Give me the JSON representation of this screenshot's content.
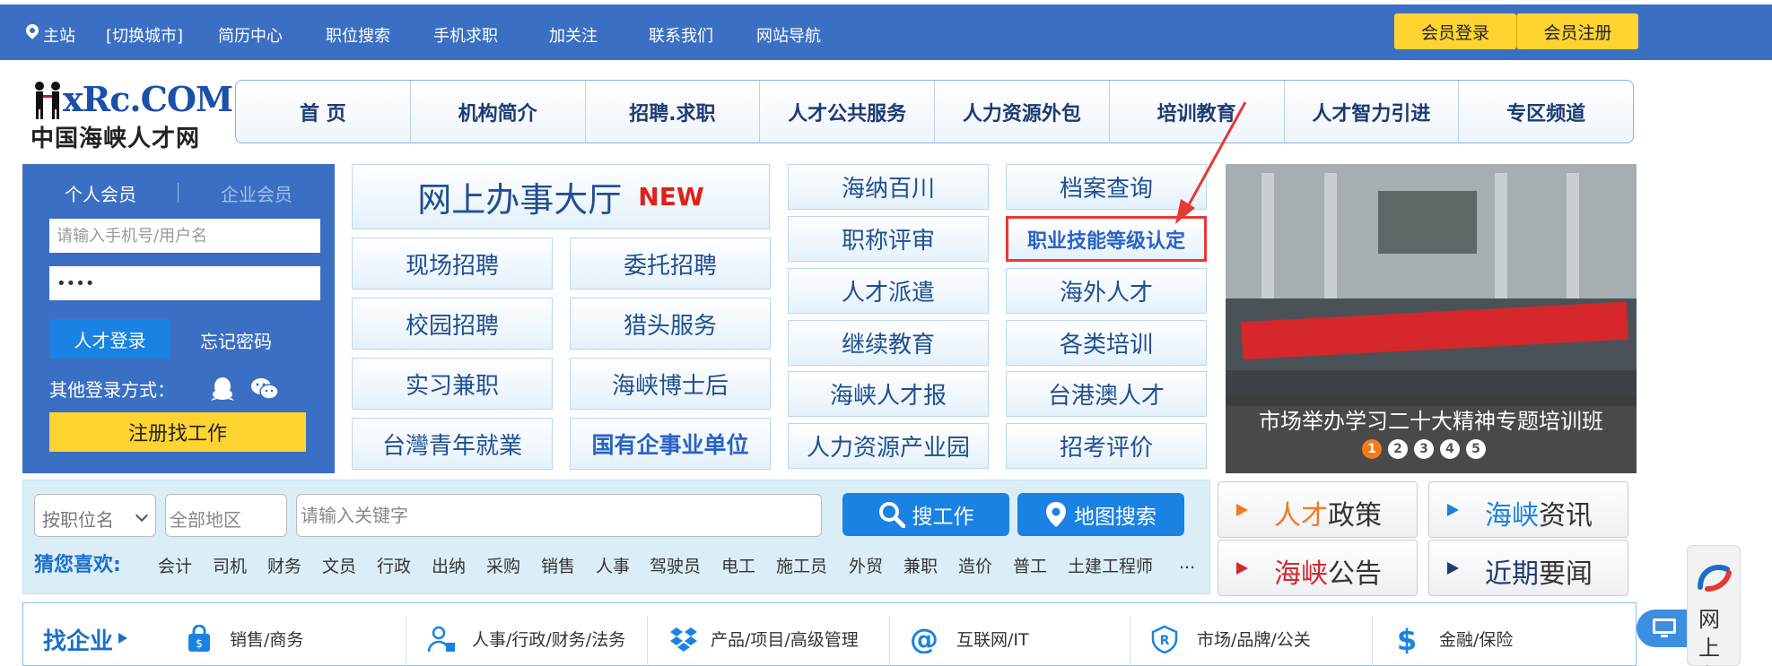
{
  "topbar": {
    "location": "主站",
    "switch_city": "[切换城市]",
    "links": [
      "简历中心",
      "职位搜索",
      "手机求职",
      "加关注",
      "联系我们",
      "网站导航"
    ],
    "member_login": "会员登录",
    "member_register": "会员注册",
    "bg_color": "#3b6fc3",
    "accent_color": "#ffd431"
  },
  "logo": {
    "text_en": "xRc.COM",
    "text_cn": "中国海峡人才网"
  },
  "main_nav": [
    "首 页",
    "机构简介",
    "招聘.求职",
    "人才公共服务",
    "人力资源外包",
    "培训教育",
    "人才智力引进",
    "专区频道"
  ],
  "login": {
    "tab_personal": "个人会员",
    "tab_company": "企业会员",
    "username_placeholder": "请输入手机号/用户名",
    "password_value": "••••",
    "login_button": "人才登录",
    "forgot": "忘记密码",
    "other_login": "其他登录方式：",
    "register_button": "注册找工作"
  },
  "services": {
    "hall": "网上办事大厅",
    "hall_badge": "NEW",
    "grid_left": [
      [
        "现场招聘",
        "委托招聘"
      ],
      [
        "校园招聘",
        "猎头服务"
      ],
      [
        "实习兼职",
        "海峡博士后"
      ],
      [
        "台灣青年就業",
        "国有企事业单位"
      ]
    ],
    "grid_right": [
      [
        "海纳百川",
        "档案查询"
      ],
      [
        "职称评审",
        "职业技能等级认定"
      ],
      [
        "人才派遣",
        "海外人才"
      ],
      [
        "继续教育",
        "各类培训"
      ],
      [
        "海峡人才报",
        "台港澳人才"
      ],
      [
        "人力资源产业园",
        "招考评价"
      ]
    ]
  },
  "banner": {
    "caption": "市场举办学习二十大精神专题培训班",
    "dots": [
      "1",
      "2",
      "3",
      "4",
      "5"
    ],
    "active_dot": 1
  },
  "search": {
    "position_select": "按职位名",
    "area": "全部地区",
    "keyword_placeholder": "请输入关键字",
    "search_button": "搜工作",
    "map_button": "地图搜索",
    "guess_label": "猜您喜欢:",
    "tags": [
      "会计",
      "司机",
      "财务",
      "文员",
      "行政",
      "出纳",
      "采购",
      "销售",
      "人事",
      "驾驶员",
      "电工",
      "施工员",
      "外贸",
      "兼职",
      "造价",
      "普工",
      "土建工程师",
      "..."
    ]
  },
  "news_buttons": [
    {
      "first": "人才",
      "rest": "政策"
    },
    {
      "first": "海峡",
      "rest": "资讯"
    },
    {
      "first": "海峡",
      "rest": "公告"
    },
    {
      "first": "近期",
      "rest": "要闻"
    }
  ],
  "find_company": {
    "label": "找企业",
    "categories": [
      "销售/商务",
      "人事/行政/财务/法务",
      "产品/项目/高级管理",
      "互联网/IT",
      "市场/品牌/公关",
      "金融/保险"
    ]
  },
  "float_panel": {
    "text": "网上办"
  }
}
